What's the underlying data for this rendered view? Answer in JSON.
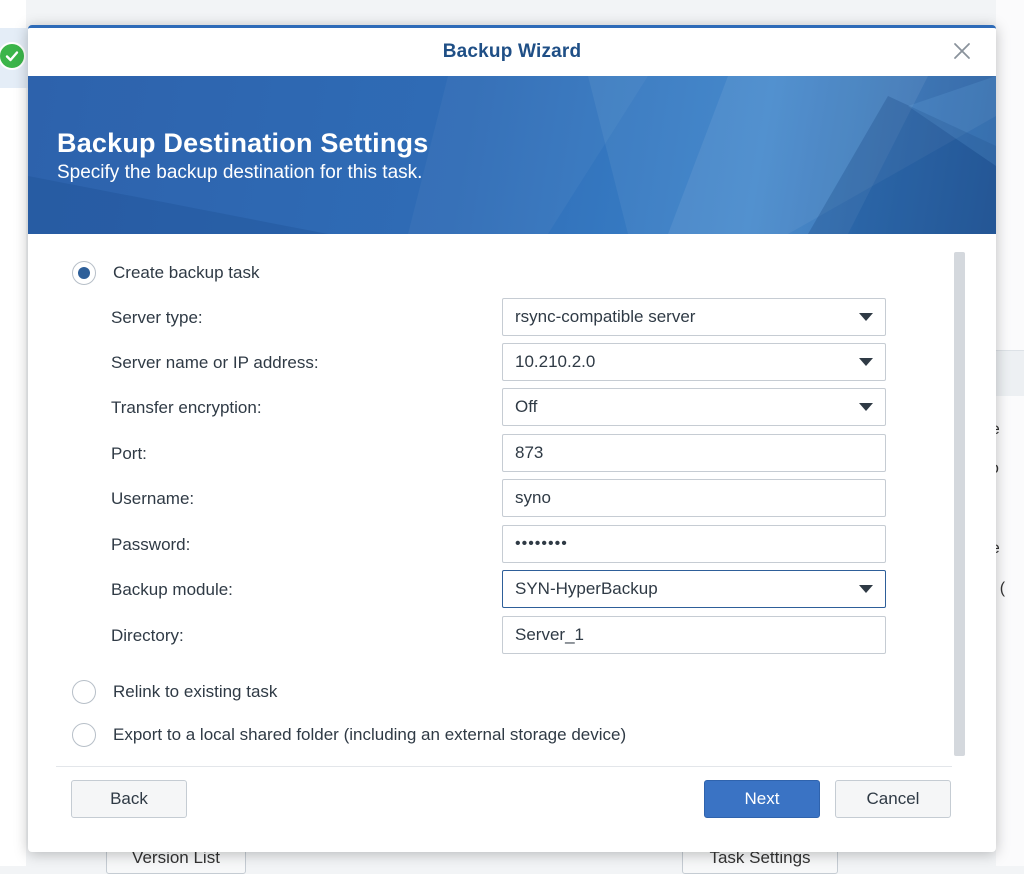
{
  "background": {
    "right_fragments": [
      "ne",
      "o",
      "ne",
      "e: ("
    ],
    "bottom_buttons": [
      "Version List",
      "Task Settings"
    ]
  },
  "dialog": {
    "title": "Backup Wizard",
    "close_icon": "close-icon",
    "banner": {
      "heading": "Backup Destination Settings",
      "subtitle": "Specify the backup destination for this task."
    },
    "options": {
      "create": {
        "label": "Create backup task",
        "selected": true
      },
      "relink": {
        "label": "Relink to existing task",
        "selected": false
      },
      "export": {
        "label": "Export to a local shared folder (including an external storage device)",
        "selected": false
      }
    },
    "fields": {
      "server_type": {
        "label": "Server type:",
        "value": "rsync-compatible server"
      },
      "server_name": {
        "label": "Server name or IP address:",
        "value": "10.210.2.0"
      },
      "encryption": {
        "label": "Transfer encryption:",
        "value": "Off"
      },
      "port": {
        "label": "Port:",
        "value": "873"
      },
      "username": {
        "label": "Username:",
        "value": "syno"
      },
      "password": {
        "label": "Password:",
        "value": "••••••••"
      },
      "module": {
        "label": "Backup module:",
        "value": "SYN-HyperBackup"
      },
      "directory": {
        "label": "Directory:",
        "value": "Server_1"
      }
    },
    "buttons": {
      "back": "Back",
      "next": "Next",
      "cancel": "Cancel"
    },
    "colors": {
      "accent": "#2e6bb8",
      "title_text": "#1f4f86",
      "primary_button": "#3a73c4"
    }
  }
}
